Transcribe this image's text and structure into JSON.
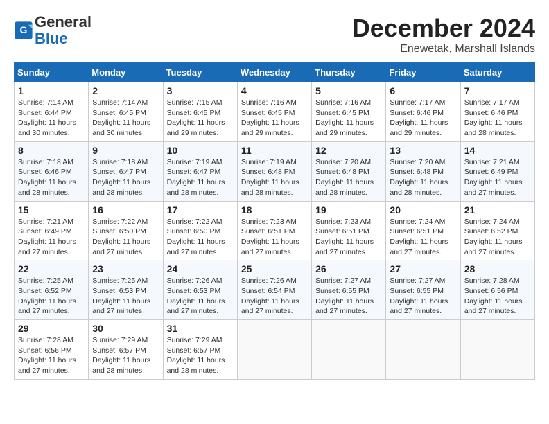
{
  "header": {
    "logo_general": "General",
    "logo_blue": "Blue",
    "month": "December 2024",
    "location": "Enewetak, Marshall Islands"
  },
  "days_of_week": [
    "Sunday",
    "Monday",
    "Tuesday",
    "Wednesday",
    "Thursday",
    "Friday",
    "Saturday"
  ],
  "weeks": [
    [
      {
        "day": "1",
        "text": "Sunrise: 7:14 AM\nSunset: 6:44 PM\nDaylight: 11 hours and 30 minutes."
      },
      {
        "day": "2",
        "text": "Sunrise: 7:14 AM\nSunset: 6:45 PM\nDaylight: 11 hours and 30 minutes."
      },
      {
        "day": "3",
        "text": "Sunrise: 7:15 AM\nSunset: 6:45 PM\nDaylight: 11 hours and 29 minutes."
      },
      {
        "day": "4",
        "text": "Sunrise: 7:16 AM\nSunset: 6:45 PM\nDaylight: 11 hours and 29 minutes."
      },
      {
        "day": "5",
        "text": "Sunrise: 7:16 AM\nSunset: 6:45 PM\nDaylight: 11 hours and 29 minutes."
      },
      {
        "day": "6",
        "text": "Sunrise: 7:17 AM\nSunset: 6:46 PM\nDaylight: 11 hours and 29 minutes."
      },
      {
        "day": "7",
        "text": "Sunrise: 7:17 AM\nSunset: 6:46 PM\nDaylight: 11 hours and 28 minutes."
      }
    ],
    [
      {
        "day": "8",
        "text": "Sunrise: 7:18 AM\nSunset: 6:46 PM\nDaylight: 11 hours and 28 minutes."
      },
      {
        "day": "9",
        "text": "Sunrise: 7:18 AM\nSunset: 6:47 PM\nDaylight: 11 hours and 28 minutes."
      },
      {
        "day": "10",
        "text": "Sunrise: 7:19 AM\nSunset: 6:47 PM\nDaylight: 11 hours and 28 minutes."
      },
      {
        "day": "11",
        "text": "Sunrise: 7:19 AM\nSunset: 6:48 PM\nDaylight: 11 hours and 28 minutes."
      },
      {
        "day": "12",
        "text": "Sunrise: 7:20 AM\nSunset: 6:48 PM\nDaylight: 11 hours and 28 minutes."
      },
      {
        "day": "13",
        "text": "Sunrise: 7:20 AM\nSunset: 6:48 PM\nDaylight: 11 hours and 28 minutes."
      },
      {
        "day": "14",
        "text": "Sunrise: 7:21 AM\nSunset: 6:49 PM\nDaylight: 11 hours and 27 minutes."
      }
    ],
    [
      {
        "day": "15",
        "text": "Sunrise: 7:21 AM\nSunset: 6:49 PM\nDaylight: 11 hours and 27 minutes."
      },
      {
        "day": "16",
        "text": "Sunrise: 7:22 AM\nSunset: 6:50 PM\nDaylight: 11 hours and 27 minutes."
      },
      {
        "day": "17",
        "text": "Sunrise: 7:22 AM\nSunset: 6:50 PM\nDaylight: 11 hours and 27 minutes."
      },
      {
        "day": "18",
        "text": "Sunrise: 7:23 AM\nSunset: 6:51 PM\nDaylight: 11 hours and 27 minutes."
      },
      {
        "day": "19",
        "text": "Sunrise: 7:23 AM\nSunset: 6:51 PM\nDaylight: 11 hours and 27 minutes."
      },
      {
        "day": "20",
        "text": "Sunrise: 7:24 AM\nSunset: 6:51 PM\nDaylight: 11 hours and 27 minutes."
      },
      {
        "day": "21",
        "text": "Sunrise: 7:24 AM\nSunset: 6:52 PM\nDaylight: 11 hours and 27 minutes."
      }
    ],
    [
      {
        "day": "22",
        "text": "Sunrise: 7:25 AM\nSunset: 6:52 PM\nDaylight: 11 hours and 27 minutes."
      },
      {
        "day": "23",
        "text": "Sunrise: 7:25 AM\nSunset: 6:53 PM\nDaylight: 11 hours and 27 minutes."
      },
      {
        "day": "24",
        "text": "Sunrise: 7:26 AM\nSunset: 6:53 PM\nDaylight: 11 hours and 27 minutes."
      },
      {
        "day": "25",
        "text": "Sunrise: 7:26 AM\nSunset: 6:54 PM\nDaylight: 11 hours and 27 minutes."
      },
      {
        "day": "26",
        "text": "Sunrise: 7:27 AM\nSunset: 6:55 PM\nDaylight: 11 hours and 27 minutes."
      },
      {
        "day": "27",
        "text": "Sunrise: 7:27 AM\nSunset: 6:55 PM\nDaylight: 11 hours and 27 minutes."
      },
      {
        "day": "28",
        "text": "Sunrise: 7:28 AM\nSunset: 6:56 PM\nDaylight: 11 hours and 27 minutes."
      }
    ],
    [
      {
        "day": "29",
        "text": "Sunrise: 7:28 AM\nSunset: 6:56 PM\nDaylight: 11 hours and 27 minutes."
      },
      {
        "day": "30",
        "text": "Sunrise: 7:29 AM\nSunset: 6:57 PM\nDaylight: 11 hours and 28 minutes."
      },
      {
        "day": "31",
        "text": "Sunrise: 7:29 AM\nSunset: 6:57 PM\nDaylight: 11 hours and 28 minutes."
      },
      {
        "day": "",
        "text": ""
      },
      {
        "day": "",
        "text": ""
      },
      {
        "day": "",
        "text": ""
      },
      {
        "day": "",
        "text": ""
      }
    ]
  ]
}
